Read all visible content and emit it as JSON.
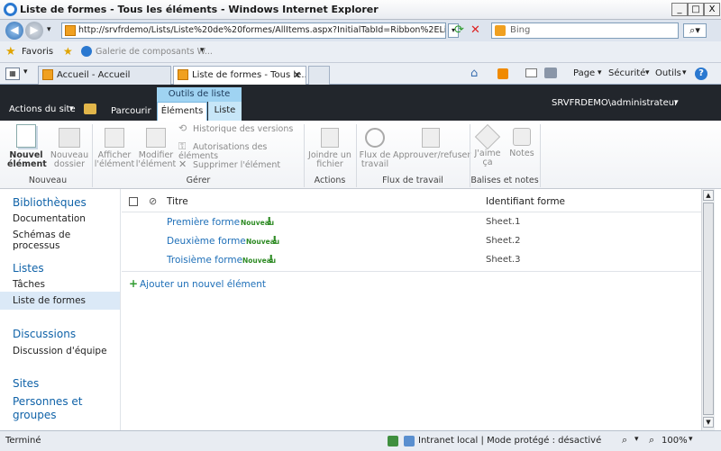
{
  "window": {
    "title": "Liste de formes - Tous les éléments - Windows Internet Explorer"
  },
  "address": {
    "url": "http://srvfrdemo/Lists/Liste%20de%20formes/AllItems.aspx?InitialTabId=Ribbon%2EListItem&Vi",
    "search_placeholder": "Bing"
  },
  "favbar": {
    "favorites": "Favoris",
    "gallery": "Galerie de composants W..."
  },
  "tabs": [
    {
      "label": "Accueil - Accueil"
    },
    {
      "label": "Liste de formes - Tous le..."
    }
  ],
  "commandbar": {
    "page": "Page",
    "security": "Sécurité",
    "tools": "Outils"
  },
  "spheader": {
    "site_actions": "Actions du site",
    "browse": "Parcourir",
    "contextual_group": "Outils de liste",
    "tab_items": "Éléments",
    "tab_list": "Liste",
    "user": "SRVFRDEMO\\administrateur"
  },
  "ribbon": {
    "new_item_1": "Nouvel",
    "new_item_2": "élément",
    "new_folder_1": "Nouveau",
    "new_folder_2": "dossier",
    "view_item_1": "Afficher",
    "view_item_2": "l'élément",
    "edit_item_1": "Modifier",
    "edit_item_2": "l'élément",
    "version_history": "Historique des versions",
    "item_permissions": "Autorisations des éléments",
    "delete_item": "Supprimer l'élément",
    "attach_file_1": "Joindre un",
    "attach_file_2": "fichier",
    "workflows_1": "Flux de",
    "workflows_2": "travail",
    "approve_reject": "Approuver/refuser",
    "like_1": "J'aime",
    "like_2": "ça",
    "notes": "Notes",
    "group_new": "Nouveau",
    "group_manage": "Gérer",
    "group_actions": "Actions",
    "group_workflow": "Flux de travail",
    "group_tags": "Balises et notes"
  },
  "leftnav": {
    "libraries": "Bibliothèques",
    "documentation": "Documentation",
    "process_diagrams": "Schémas de processus",
    "lists": "Listes",
    "tasks": "Tâches",
    "shape_list": "Liste de formes",
    "discussions": "Discussions",
    "team_discussion": "Discussion d'équipe",
    "sites": "Sites",
    "people_groups_1": "Personnes et",
    "people_groups_2": "groupes"
  },
  "list": {
    "col_title": "Titre",
    "col_shape_id": "Identifiant forme",
    "new_badge": "Nouveau",
    "rows": [
      {
        "title": "Première forme",
        "shape_id": "Sheet.1"
      },
      {
        "title": "Deuxième forme",
        "shape_id": "Sheet.2"
      },
      {
        "title": "Troisième forme",
        "shape_id": "Sheet.3"
      }
    ],
    "add_item": "Ajouter un nouvel élément"
  },
  "status": {
    "done": "Terminé",
    "zone": "Intranet local | Mode protégé : désactivé",
    "zoom": "100%"
  }
}
